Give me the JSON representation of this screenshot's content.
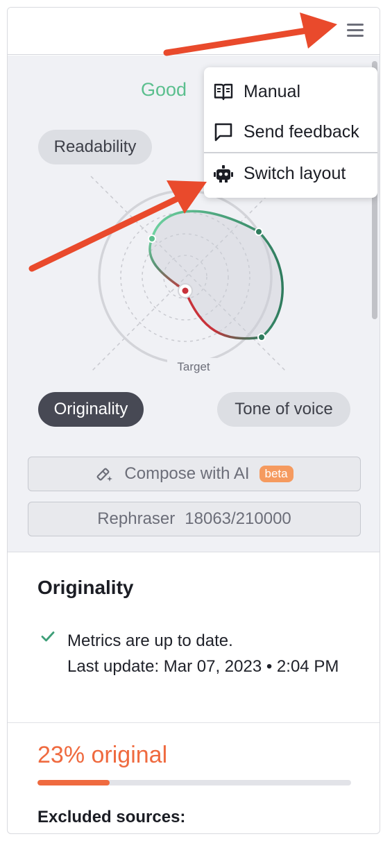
{
  "header": {
    "menu_icon": "hamburger-icon"
  },
  "menu": {
    "items": [
      {
        "label": "Manual",
        "icon": "book-icon"
      },
      {
        "label": "Send feedback",
        "icon": "feedback-icon"
      },
      {
        "label": "Switch layout",
        "icon": "robot-icon"
      }
    ]
  },
  "score": {
    "label": "Good"
  },
  "radar": {
    "axes": [
      "Readability",
      "Originality",
      "Tone of voice"
    ],
    "selected": "Originality",
    "target_label": "Target"
  },
  "actions": {
    "compose": {
      "label": "Compose with AI",
      "badge": "beta",
      "icon": "magic-wand-icon"
    },
    "rephraser": {
      "label": "Rephraser",
      "count": "18063/210000"
    }
  },
  "originality": {
    "title": "Originality",
    "status_line1": "Metrics are up to date.",
    "status_line2": "Last update: Mar 07, 2023 • 2:04 PM",
    "percent_label": "23% original",
    "percent": 23,
    "excluded_label": "Excluded sources:"
  },
  "colors": {
    "good": "#5bbf8e",
    "accent_orange": "#ef6a3f",
    "annotation_arrow": "#e94a2c",
    "dark_pill": "#474954"
  }
}
